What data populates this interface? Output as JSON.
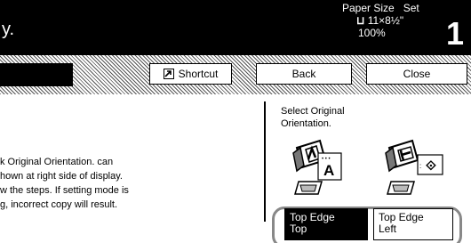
{
  "header": {
    "title": "y.",
    "paper_size_label": "Paper Size",
    "set_label": "Set",
    "paper_size_value": "11×8½\"",
    "zoom": "100%",
    "copies": "1"
  },
  "toolbar": {
    "shortcut_label": "Shortcut",
    "back_label": "Back",
    "close_label": "Close"
  },
  "message": {
    "line1": "k Original Orientation. can",
    "line2": "hown at right side of display.",
    "line3": "w the steps. If setting mode is",
    "line4": "g, incorrect copy will result."
  },
  "orientation_panel": {
    "prompt_line1": "Select Original",
    "prompt_line2": "Orientation.",
    "options": [
      {
        "line1": "Top Edge",
        "line2": "Top",
        "selected": true
      },
      {
        "line1": "Top Edge",
        "line2": "Left",
        "selected": false
      }
    ]
  },
  "colors": {
    "header_bg": "#000000",
    "selected_bg": "#000000",
    "highlight_ring": "#888888"
  },
  "icons": {
    "shortcut": "shortcut-arrow-icon",
    "paper": "landscape-paper-icon",
    "top_edge_top": "original-top-edge-top-icon",
    "top_edge_left": "original-top-edge-left-icon"
  }
}
